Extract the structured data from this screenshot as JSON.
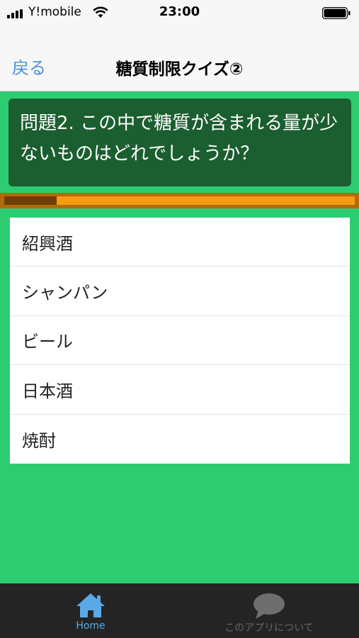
{
  "status_bar": {
    "carrier": "Y!mobile",
    "time": "23:00"
  },
  "nav": {
    "back_label": "戻る",
    "title": "糖質制限クイズ②"
  },
  "question": {
    "text": "問題2. この中で糖質が含まれる量が少ないものはどれでしょうか？"
  },
  "progress": {
    "fraction": 0.15
  },
  "choices": [
    "紹興酒",
    "シャンパン",
    "ビール",
    "日本酒",
    "焼酎"
  ],
  "tab_bar": {
    "home_label": "Home",
    "about_label": "このアプリについて",
    "home_icon": "home-icon",
    "about_icon": "chat-bubble-icon"
  },
  "colors": {
    "background": "#2ecc71",
    "question_bg": "#1b5e30",
    "progress_track": "#f39c12",
    "progress_done": "#6b3f05",
    "tab_active": "#5aa9e6",
    "link": "#4a90d9"
  }
}
